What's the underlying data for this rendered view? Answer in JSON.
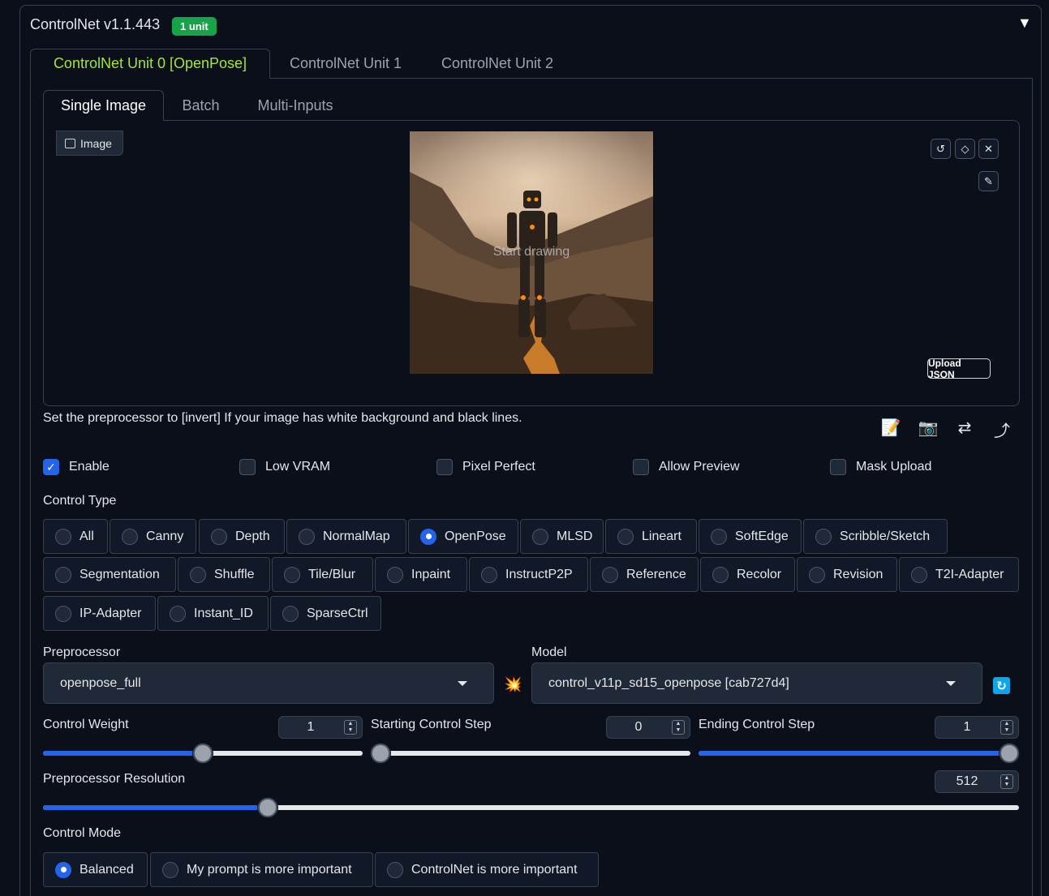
{
  "header": {
    "title": "ControlNet v1.1.443",
    "badge": "1 unit",
    "collapse_icon": "▼"
  },
  "unit_tabs": [
    {
      "label": "ControlNet Unit 0 [OpenPose]",
      "active": true
    },
    {
      "label": "ControlNet Unit 1",
      "active": false
    },
    {
      "label": "ControlNet Unit 2",
      "active": false
    }
  ],
  "image_tabs": [
    {
      "label": "Single Image",
      "active": true
    },
    {
      "label": "Batch",
      "active": false
    },
    {
      "label": "Multi-Inputs",
      "active": false
    }
  ],
  "image_panel": {
    "label": "Image",
    "overlay_text": "Start drawing",
    "tools": [
      "undo-icon",
      "eraser-icon",
      "close-icon",
      "brush-icon"
    ],
    "upload_json_label": "Upload JSON"
  },
  "hint": "Set the preprocessor to [invert] If your image has white background and black lines.",
  "action_icons": [
    "notepad-icon",
    "camera-icon",
    "swap-icon",
    "send-icon"
  ],
  "options": [
    {
      "label": "Enable",
      "checked": true
    },
    {
      "label": "Low VRAM",
      "checked": false
    },
    {
      "label": "Pixel Perfect",
      "checked": false
    },
    {
      "label": "Allow Preview",
      "checked": false
    },
    {
      "label": "Mask Upload",
      "checked": false
    }
  ],
  "control_type": {
    "label": "Control Type",
    "selected": "OpenPose",
    "options": [
      "All",
      "Canny",
      "Depth",
      "NormalMap",
      "OpenPose",
      "MLSD",
      "Lineart",
      "SoftEdge",
      "Scribble/Sketch",
      "Segmentation",
      "Shuffle",
      "Tile/Blur",
      "Inpaint",
      "InstructP2P",
      "Reference",
      "Recolor",
      "Revision",
      "T2I-Adapter",
      "IP-Adapter",
      "Instant_ID",
      "SparseCtrl"
    ]
  },
  "preprocessor": {
    "label": "Preprocessor",
    "value": "openpose_full"
  },
  "model": {
    "label": "Model",
    "value": "control_v11p_sd15_openpose [cab727d4]"
  },
  "sliders": {
    "control_weight": {
      "label": "Control Weight",
      "value": "1",
      "fraction": 0.5
    },
    "starting_step": {
      "label": "Starting Control Step",
      "value": "0",
      "fraction": 0.0
    },
    "ending_step": {
      "label": "Ending Control Step",
      "value": "1",
      "fraction": 1.0
    },
    "resolution": {
      "label": "Preprocessor Resolution",
      "value": "512",
      "fraction": 0.23
    }
  },
  "control_mode": {
    "label": "Control Mode",
    "selected": "Balanced",
    "options": [
      "Balanced",
      "My prompt is more important",
      "ControlNet is more important"
    ]
  },
  "colors": {
    "accent": "#2563eb",
    "active_tab": "#a3e635",
    "badge": "#16a34a"
  }
}
